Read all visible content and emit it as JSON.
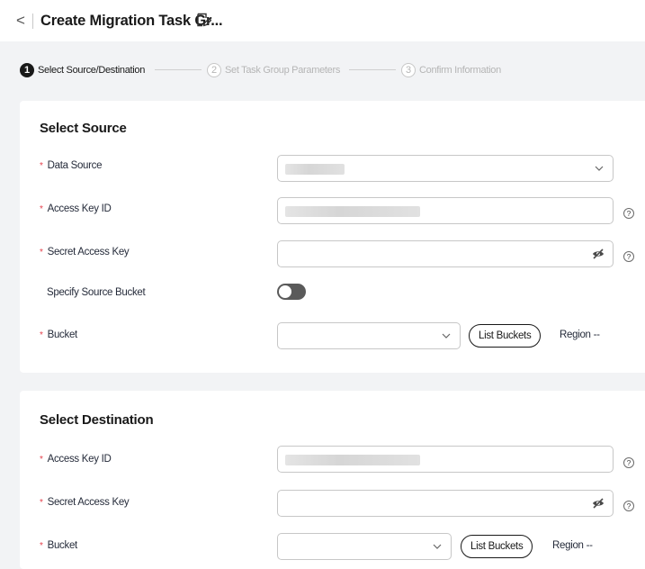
{
  "header": {
    "back_glyph": "<",
    "title": "Create Migration Task Gr...",
    "edit_icon": "edit-note-icon"
  },
  "steps": [
    {
      "number": "1",
      "label": "Select Source/Destination",
      "state": "active"
    },
    {
      "number": "2",
      "label": "Set Task Group Parameters",
      "state": "inactive"
    },
    {
      "number": "3",
      "label": "Confirm Information",
      "state": "inactive"
    }
  ],
  "source": {
    "title": "Select Source",
    "required_marker": "*",
    "data_source_label": "Data Source",
    "access_key_label": "Access Key ID",
    "secret_key_label": "Secret Access Key",
    "specify_bucket_label": "Specify Source Bucket",
    "specify_bucket_enabled": false,
    "bucket_label": "Bucket",
    "list_buckets_label": "List Buckets",
    "region_label": "Region",
    "region_value": "--"
  },
  "destination": {
    "title": "Select Destination",
    "required_marker": "*",
    "access_key_label": "Access Key ID",
    "secret_key_label": "Secret Access Key",
    "bucket_label": "Bucket",
    "list_buckets_label": "List Buckets",
    "region_label": "Region",
    "region_value": "--"
  },
  "help_glyph": "?",
  "colors": {
    "accent": "#191919",
    "required": "#e5414c",
    "page_bg": "#f2f3f5",
    "toggle_off": "#5a5a5a"
  }
}
